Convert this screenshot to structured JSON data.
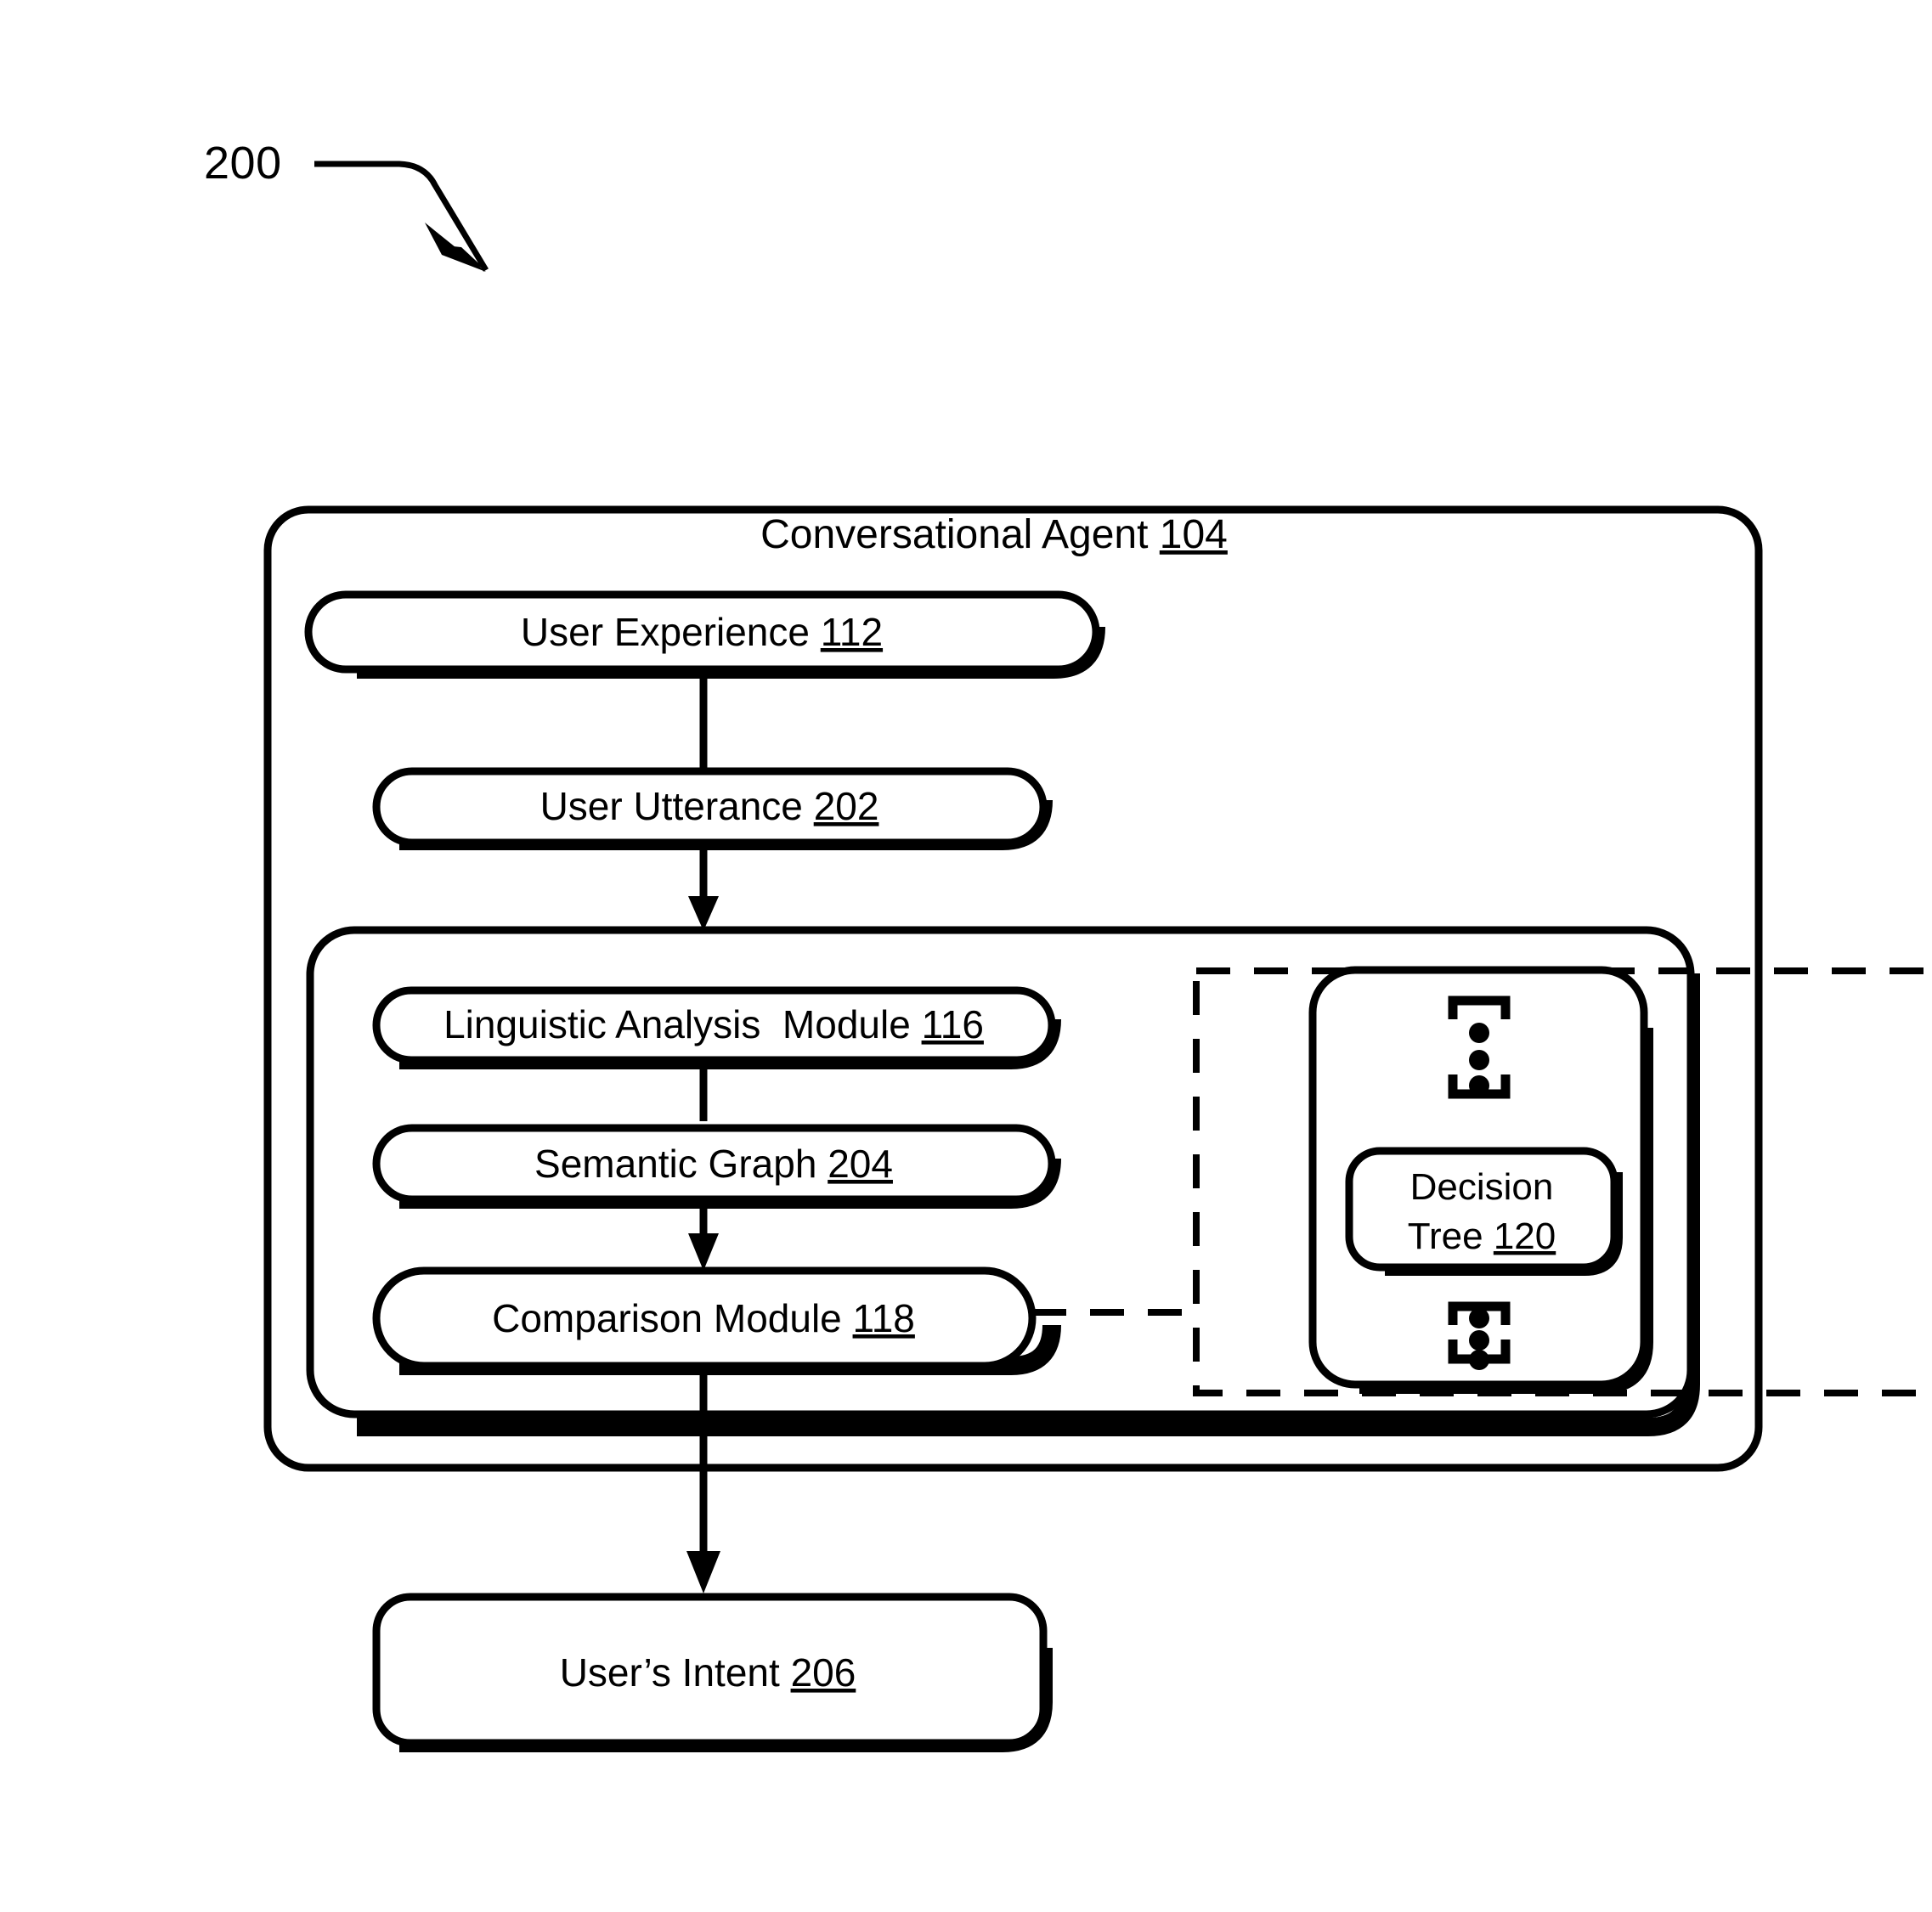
{
  "figure": {
    "number": "200",
    "leader_line": "curved-arrow-pointing-into-diagram"
  },
  "outer_container": {
    "name": "Conversational Agent",
    "title_label": "Conversational Agent",
    "reference_numeral": "104"
  },
  "nodes": {
    "user_experience": {
      "label": "User Experience",
      "reference_numeral": "112"
    },
    "user_utterance": {
      "label": "User Utterance",
      "reference_numeral": "202"
    },
    "linguistic_analysis_module": {
      "label": "Linguistic Analysis  Module",
      "reference_numeral": "116"
    },
    "semantic_graph": {
      "label": "Semantic Graph",
      "reference_numeral": "204"
    },
    "comparison_module": {
      "label": "Comparison Module",
      "reference_numeral": "118"
    },
    "decision_tree": {
      "label_line_1": "Decision",
      "label_line_2": "Tree",
      "reference_numeral": "120"
    },
    "users_intent": {
      "label": "User’s Intent",
      "reference_numeral": "206"
    }
  },
  "ellipsis_markers": {
    "top": "vertical-ellipsis-bracketed",
    "bottom": "vertical-ellipsis-bracketed"
  },
  "connectors": [
    {
      "from": "user_experience",
      "to": "user_utterance",
      "style": "solid",
      "arrow": false
    },
    {
      "from": "user_utterance",
      "to": "linguistic_analysis_module",
      "style": "solid",
      "arrow": true
    },
    {
      "from": "linguistic_analysis_module",
      "to": "semantic_graph",
      "style": "solid",
      "arrow": false
    },
    {
      "from": "semantic_graph",
      "to": "comparison_module",
      "style": "solid",
      "arrow": true
    },
    {
      "from": "comparison_module",
      "to": "users_intent",
      "style": "solid",
      "arrow": true
    },
    {
      "from": "comparison_module",
      "to": "decision_tree_group",
      "style": "dashed",
      "arrow": false
    }
  ],
  "colors": {
    "stroke": "#000000",
    "fill": "#ffffff",
    "background": "#ffffff"
  }
}
